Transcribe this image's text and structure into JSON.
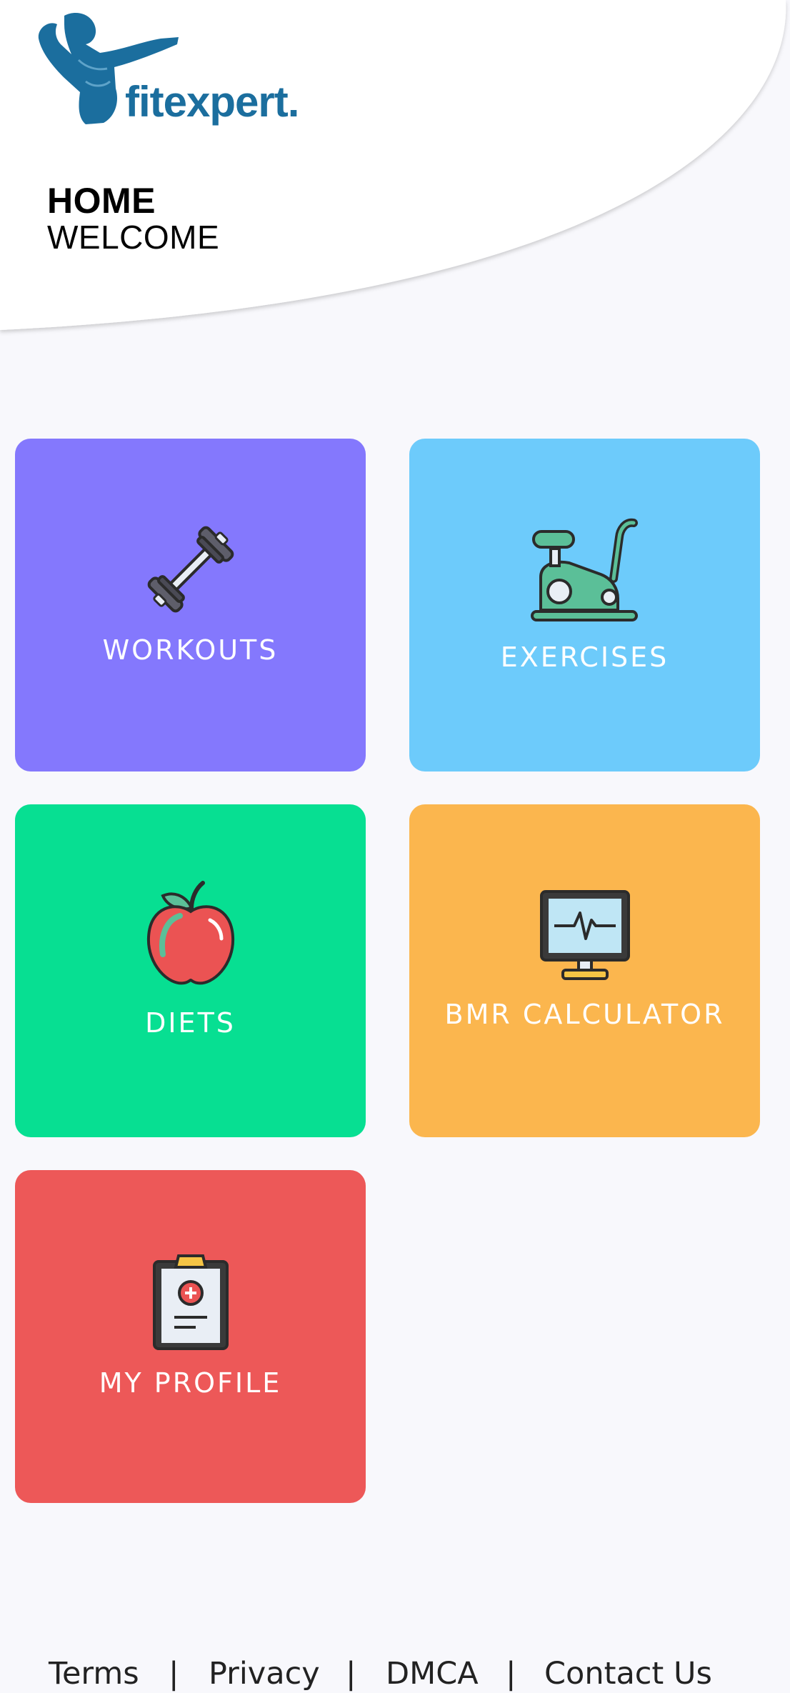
{
  "header": {
    "logo_text": "fitexpert.",
    "title": "HOME",
    "subtitle": "WELCOME"
  },
  "tiles": [
    {
      "label": "WORKOUTS",
      "icon": "dumbbell-icon",
      "color": "#8478fd"
    },
    {
      "label": "EXERCISES",
      "icon": "exercise-bike-icon",
      "color": "#6dcbfb"
    },
    {
      "label": "DIETS",
      "icon": "apple-icon",
      "color": "#07df92"
    },
    {
      "label": "BMR CALCULATOR",
      "icon": "heart-monitor-icon",
      "color": "#fbb64e"
    },
    {
      "label": "MY PROFILE",
      "icon": "clipboard-profile-icon",
      "color": "#ed5858"
    }
  ],
  "footer": {
    "links": [
      "Terms",
      "Privacy",
      "DMCA",
      "Contact Us"
    ],
    "separator": "|"
  },
  "colors": {
    "brand": "#1b6e9e",
    "background": "#f8f8fc"
  }
}
